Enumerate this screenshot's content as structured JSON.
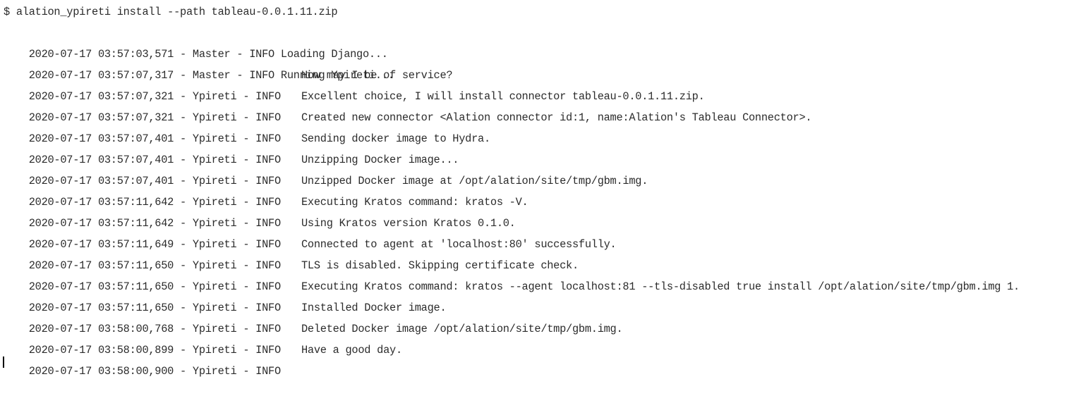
{
  "terminal": {
    "command": "$ alation_ypireti install --path tableau-0.0.1.11.zip",
    "lines": [
      {
        "prefix": "2020-07-17 03:57:03,571 - Master - INFO Loading Django...",
        "message": ""
      },
      {
        "prefix": "2020-07-17 03:57:07,317 - Master - INFO Running Ypireti...",
        "message": ""
      },
      {
        "prefix": "2020-07-17 03:57:07,321 - Ypireti - INFO",
        "message": "How may I be of service?"
      },
      {
        "prefix": "2020-07-17 03:57:07,321 - Ypireti - INFO",
        "message": "Excellent choice, I will install connector tableau-0.0.1.11.zip."
      },
      {
        "prefix": "2020-07-17 03:57:07,401 - Ypireti - INFO",
        "message": "Created new connector <Alation connector id:1, name:Alation's Tableau Connector>."
      },
      {
        "prefix": "2020-07-17 03:57:07,401 - Ypireti - INFO",
        "message": "Sending docker image to Hydra."
      },
      {
        "prefix": "2020-07-17 03:57:07,401 - Ypireti - INFO",
        "message": "Unzipping Docker image..."
      },
      {
        "prefix": "2020-07-17 03:57:11,642 - Ypireti - INFO",
        "message": "Unzipped Docker image at /opt/alation/site/tmp/gbm.img."
      },
      {
        "prefix": "2020-07-17 03:57:11,642 - Ypireti - INFO",
        "message": "Executing Kratos command: kratos -V."
      },
      {
        "prefix": "2020-07-17 03:57:11,649 - Ypireti - INFO",
        "message": "Using Kratos version Kratos 0.1.0."
      },
      {
        "prefix": "2020-07-17 03:57:11,650 - Ypireti - INFO",
        "message": "Connected to agent at 'localhost:80' successfully."
      },
      {
        "prefix": "2020-07-17 03:57:11,650 - Ypireti - INFO",
        "message": "TLS is disabled. Skipping certificate check."
      },
      {
        "prefix": "2020-07-17 03:57:11,650 - Ypireti - INFO",
        "message": "Executing Kratos command: kratos --agent localhost:81 --tls-disabled true install /opt/alation/site/tmp/gbm.img 1."
      },
      {
        "prefix": "2020-07-17 03:58:00,768 - Ypireti - INFO",
        "message": "Installed Docker image."
      },
      {
        "prefix": "2020-07-17 03:58:00,899 - Ypireti - INFO",
        "message": "Deleted Docker image /opt/alation/site/tmp/gbm.img."
      },
      {
        "prefix": "2020-07-17 03:58:00,900 - Ypireti - INFO",
        "message": "Have a good day."
      }
    ]
  }
}
